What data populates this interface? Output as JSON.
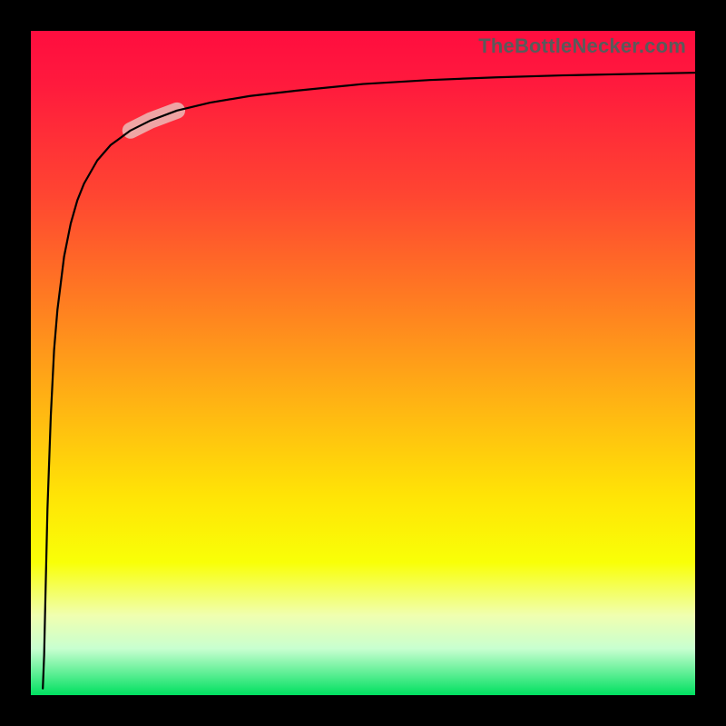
{
  "watermark": "TheBottleNecker.com",
  "chart_data": {
    "type": "line",
    "title": "",
    "xlabel": "",
    "ylabel": "",
    "xlim": [
      0,
      100
    ],
    "ylim": [
      0,
      100
    ],
    "x": [
      1.8,
      2.0,
      2.2,
      2.5,
      3.0,
      3.5,
      4.0,
      5.0,
      6.0,
      7.0,
      8.0,
      10.0,
      12.0,
      15.0,
      18.0,
      22.0,
      27.0,
      33.0,
      40.0,
      50.0,
      60.0,
      70.0,
      80.0,
      90.0,
      100.0
    ],
    "y": [
      1.0,
      6.0,
      15.0,
      28.0,
      42.0,
      52.0,
      58.0,
      66.0,
      71.0,
      74.5,
      77.0,
      80.5,
      82.8,
      85.0,
      86.5,
      88.0,
      89.2,
      90.2,
      91.0,
      92.0,
      92.6,
      93.0,
      93.3,
      93.5,
      93.7
    ],
    "highlight_segment": {
      "x_range": [
        14,
        22
      ],
      "y_range": [
        84,
        88
      ]
    },
    "background_gradient": {
      "top": "#ff0d3f",
      "mid1": "#ff7a22",
      "mid2": "#ffe406",
      "bottom": "#00e060"
    }
  }
}
